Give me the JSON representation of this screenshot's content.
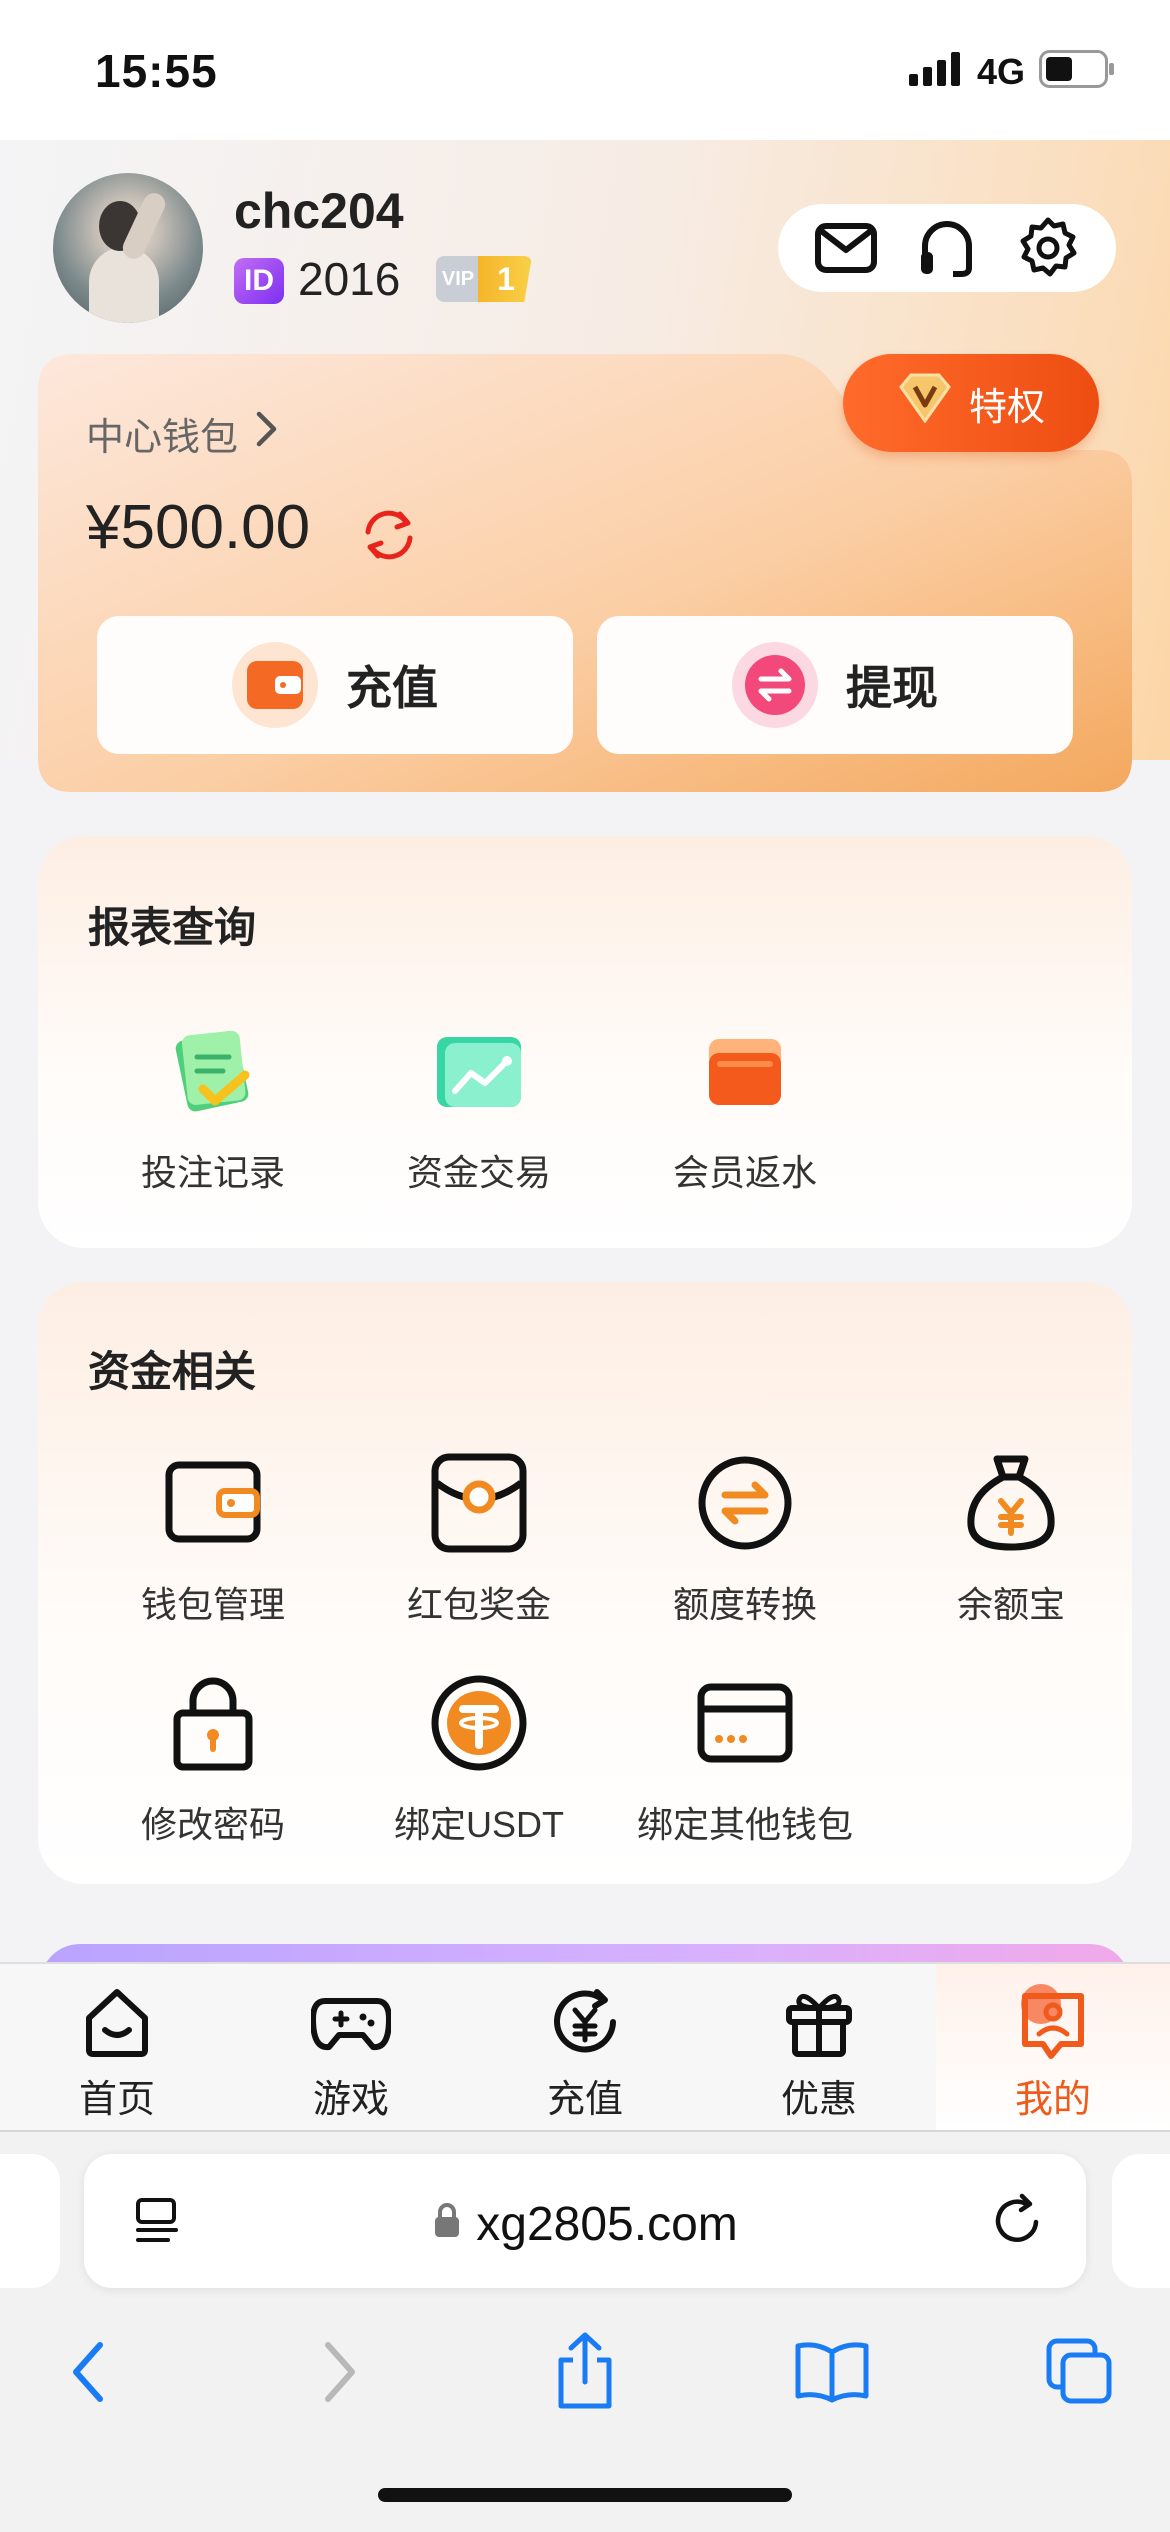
{
  "status_bar": {
    "time": "15:55",
    "network": "4G"
  },
  "profile": {
    "username": "chc204",
    "id_badge": "ID",
    "id_value": "2016",
    "vip_text": "VIP",
    "vip_level": "1"
  },
  "header_icons": [
    "mail-icon",
    "headset-icon",
    "gear-icon"
  ],
  "wallet": {
    "title": "中心钱包",
    "balance": "¥500.00",
    "privilege_label": "特权",
    "deposit_label": "充值",
    "withdraw_label": "提现"
  },
  "reports": {
    "title": "报表查询",
    "items": [
      {
        "label": "投注记录",
        "icon": "betting-record-icon"
      },
      {
        "label": "资金交易",
        "icon": "fund-transaction-icon"
      },
      {
        "label": "会员返水",
        "icon": "member-rebate-icon"
      }
    ]
  },
  "funds": {
    "title": "资金相关",
    "items": [
      {
        "label": "钱包管理",
        "icon": "wallet-icon"
      },
      {
        "label": "红包奖金",
        "icon": "red-envelope-icon"
      },
      {
        "label": "额度转换",
        "icon": "transfer-icon"
      },
      {
        "label": "余额宝",
        "icon": "money-bag-icon"
      },
      {
        "label": "修改密码",
        "icon": "lock-icon"
      },
      {
        "label": "绑定USDT",
        "icon": "usdt-icon"
      },
      {
        "label": "绑定其他钱包",
        "icon": "card-icon"
      }
    ]
  },
  "tabbar": {
    "items": [
      {
        "label": "首页",
        "icon": "home-icon"
      },
      {
        "label": "游戏",
        "icon": "gamepad-icon"
      },
      {
        "label": "充值",
        "icon": "recharge-icon"
      },
      {
        "label": "优惠",
        "icon": "gift-icon"
      },
      {
        "label": "我的",
        "icon": "profile-icon"
      }
    ],
    "active": "我的",
    "accent_color": "#f05a1a"
  },
  "browser": {
    "url": "xg2805.com"
  },
  "colors": {
    "accent_orange": "#ee4d12",
    "usdt_orange": "#f28a22"
  }
}
